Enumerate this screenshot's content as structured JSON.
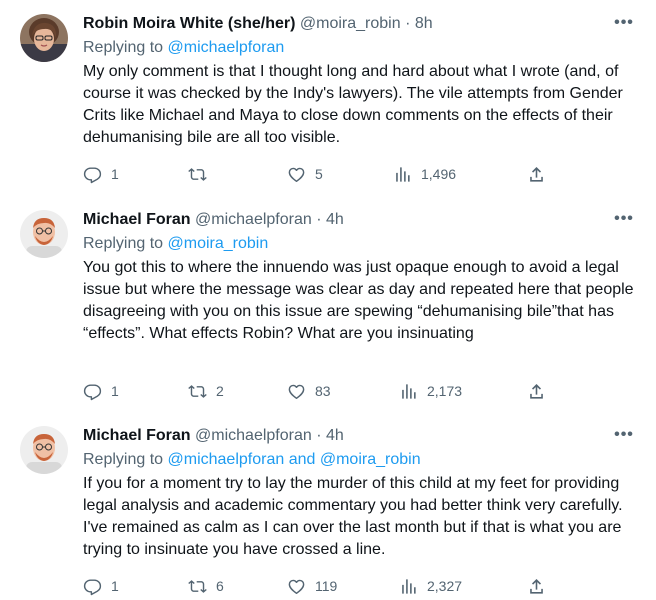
{
  "tweets": [
    {
      "name": "Robin Moira White (she/her)",
      "handle": "@moira_robin",
      "separator": "·",
      "time": "8h",
      "replying_prefix": "Replying to",
      "replying_to": "@michaelpforan",
      "replying_conj": "",
      "replying_to_2": "",
      "text": "My only comment is that I thought long and hard about what I wrote (and, of course it was checked by the Indy's lawyers). The vile attempts from Gender Crits like Michael and Maya to close down comments on the effects of their dehumanising bile are all too visible.",
      "replies": "1",
      "retweets": "",
      "likes": "5",
      "views": "1,496"
    },
    {
      "name": "Michael Foran",
      "handle": "@michaelpforan",
      "separator": "·",
      "time": "4h",
      "replying_prefix": "Replying to",
      "replying_to": "@moira_robin",
      "replying_conj": "",
      "replying_to_2": "",
      "text": "You got this to where the innuendo was just opaque enough to avoid a legal issue but where the message was clear as day and repeated here that people disagreeing with you on this issue are spewing “dehumanising bile”that has “effects”. What effects Robin? What are you insinuating",
      "replies": "1",
      "retweets": "2",
      "likes": "83",
      "views": "2,173"
    },
    {
      "name": "Michael Foran",
      "handle": "@michaelpforan",
      "separator": "·",
      "time": "4h",
      "replying_prefix": "Replying to",
      "replying_to": "@michaelpforan",
      "replying_conj": "and",
      "replying_to_2": "@moira_robin",
      "text": "If you for a moment try to lay the murder of this child at my feet for providing legal analysis and academic commentary you had better think very carefully. I've remained as calm as I can over the last month but if that is what you are trying to insinuate you have crossed a line.",
      "replies": "1",
      "retweets": "6",
      "likes": "119",
      "views": "2,327"
    }
  ],
  "icons": {
    "reply": "reply-icon",
    "retweet": "retweet-icon",
    "like": "heart-icon",
    "views": "views-chart-icon",
    "share": "share-icon",
    "more": "more-icon"
  },
  "colors": {
    "text": "#0f1419",
    "secondary": "#536471",
    "link": "#1d9bf0"
  }
}
